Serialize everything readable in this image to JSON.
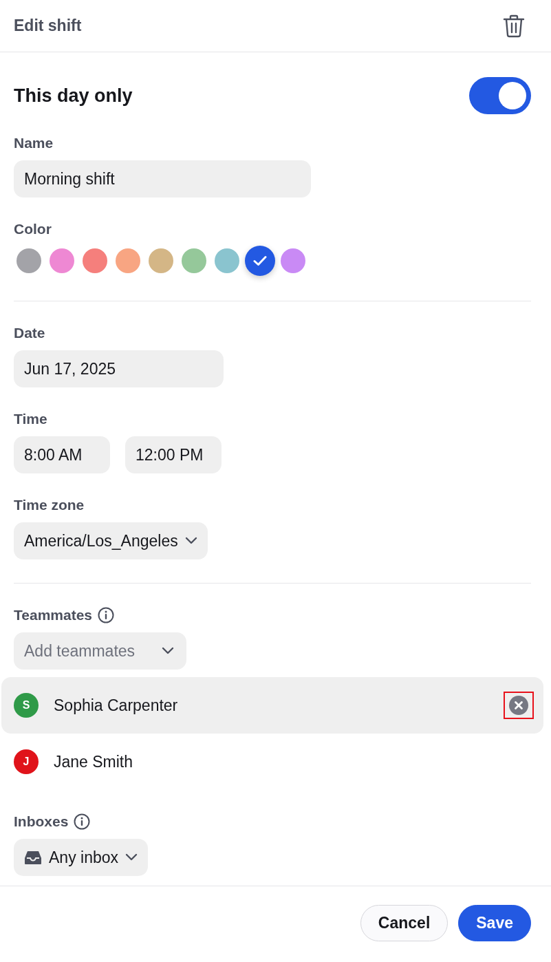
{
  "header": {
    "title": "Edit shift"
  },
  "this_day_only": {
    "label": "This day only",
    "on": true
  },
  "name": {
    "label": "Name",
    "value": "Morning shift"
  },
  "color": {
    "label": "Color",
    "swatches": [
      {
        "color": "#a3a3a8",
        "selected": false
      },
      {
        "color": "#ee88d3",
        "selected": false
      },
      {
        "color": "#f57f7c",
        "selected": false
      },
      {
        "color": "#f8a582",
        "selected": false
      },
      {
        "color": "#d4b686",
        "selected": false
      },
      {
        "color": "#95c89a",
        "selected": false
      },
      {
        "color": "#8ac4cf",
        "selected": false
      },
      {
        "color": "#2359e2",
        "selected": true
      },
      {
        "color": "#c98af5",
        "selected": false
      }
    ]
  },
  "date": {
    "label": "Date",
    "value": "Jun 17, 2025"
  },
  "time": {
    "label": "Time",
    "start": "8:00 AM",
    "end": "12:00 PM"
  },
  "time_zone": {
    "label": "Time zone",
    "value": "America/Los_Angeles"
  },
  "teammates": {
    "label": "Teammates",
    "placeholder": "Add teammates",
    "members": [
      {
        "initial": "S",
        "name": "Sophia Carpenter",
        "color": "#2f9a48",
        "hovered": true,
        "remove_highlighted": true
      },
      {
        "initial": "J",
        "name": "Jane Smith",
        "color": "#e0131a",
        "hovered": false
      }
    ]
  },
  "inboxes": {
    "label": "Inboxes",
    "value": "Any inbox"
  },
  "buttons": [
    {
      "label": "Cancel",
      "kind": "secondary"
    },
    {
      "label": "Save",
      "kind": "primary"
    }
  ]
}
